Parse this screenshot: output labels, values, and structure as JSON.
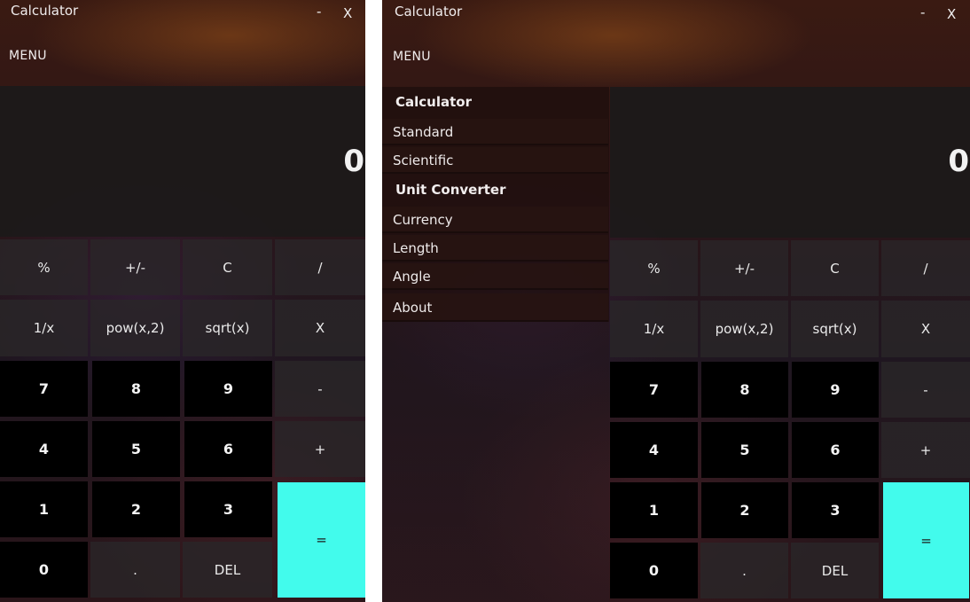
{
  "app": {
    "title": "Calculator",
    "minimize_label": "-",
    "close_label": "X",
    "menu_label": "MENU"
  },
  "display": {
    "value": "0"
  },
  "keys": {
    "percent": "%",
    "negate": "+/-",
    "clear": "C",
    "divide": "/",
    "reciprocal": "1/x",
    "square": "pow(x,2)",
    "sqrt": "sqrt(x)",
    "multiply": "X",
    "seven": "7",
    "eight": "8",
    "nine": "9",
    "subtract": "-",
    "four": "4",
    "five": "5",
    "six": "6",
    "add": "+",
    "one": "1",
    "two": "2",
    "three": "3",
    "equals": "=",
    "zero": "0",
    "decimal": ".",
    "delete": "DEL"
  },
  "nav_menu": {
    "section_calculator": "Calculator",
    "standard": "Standard",
    "scientific": "Scientific",
    "section_converter": "Unit Converter",
    "currency": "Currency",
    "length": "Length",
    "angle": "Angle",
    "about": "About"
  },
  "colors": {
    "equals_key": "#42fbec",
    "number_key": "#000000",
    "operator_key": "#2a2628",
    "display_bg": "#1c1a1a"
  }
}
